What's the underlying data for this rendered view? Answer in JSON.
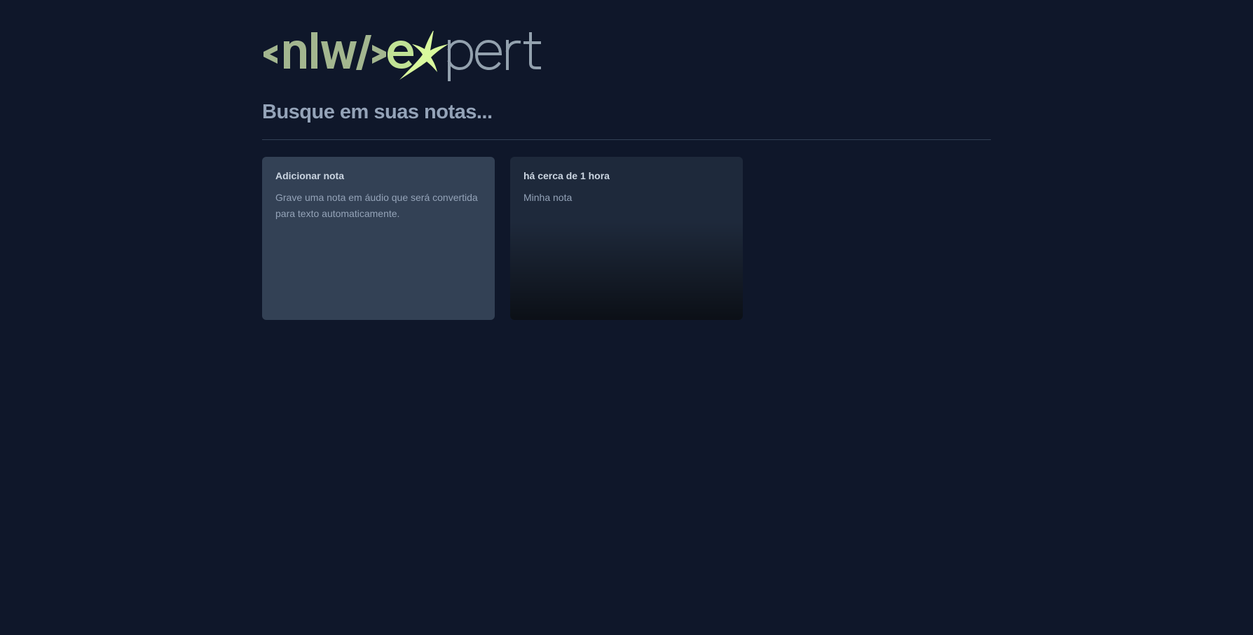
{
  "logo": {
    "alt": "nlw expert",
    "left_part": "<nlw/>",
    "right_part": "expert",
    "colors": {
      "left": "#a3b68f",
      "right_accent": "#c1e295",
      "right_gray": "#93a1ae",
      "star": "#d9f99d"
    }
  },
  "search": {
    "placeholder": "Busque em suas notas...",
    "value": ""
  },
  "cards": {
    "add_note": {
      "title": "Adicionar nota",
      "description": "Grave uma nota em áudio que será convertida para texto automaticamente."
    },
    "note": {
      "date": "há cerca de 1 hora",
      "content": "Minha nota"
    }
  },
  "colors": {
    "background": "#0f172a",
    "card_add": "#334155",
    "card_note": "#1e293b",
    "divider": "#334155"
  }
}
